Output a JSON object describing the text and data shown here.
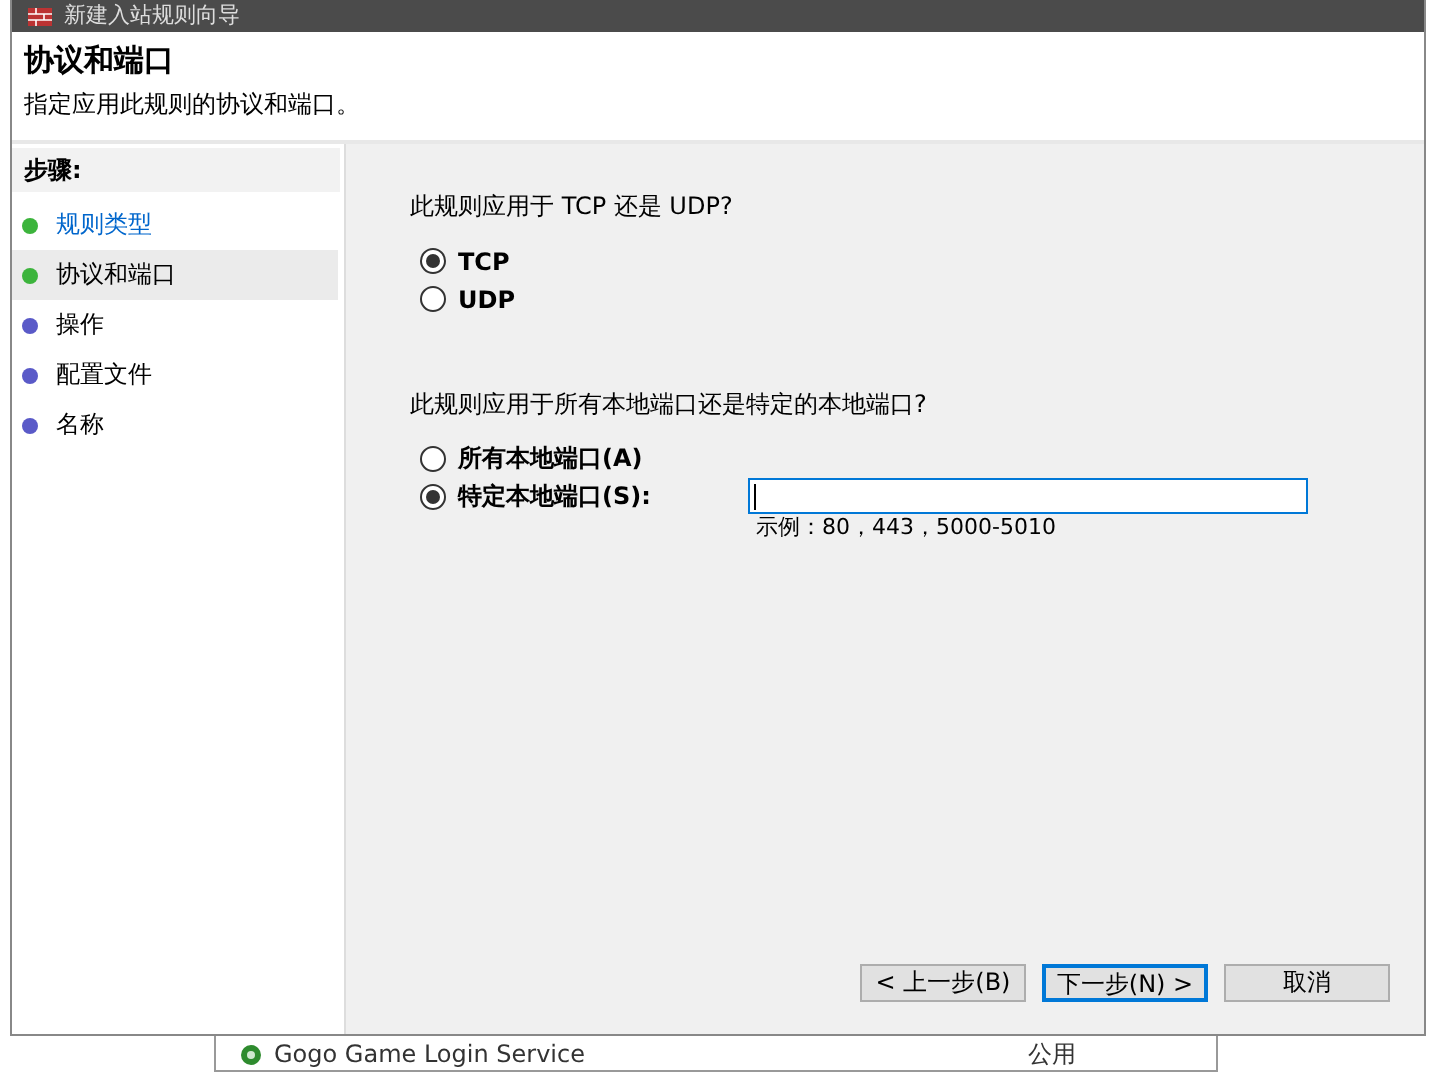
{
  "window": {
    "title": "新建入站规则向导"
  },
  "header": {
    "title": "协议和端口",
    "subtitle": "指定应用此规则的协议和端口。"
  },
  "steps": {
    "heading": "步骤:",
    "items": [
      {
        "label": "规则类型",
        "kind": "link",
        "color": "#3cb43c",
        "selected": false
      },
      {
        "label": "协议和端口",
        "kind": "plain",
        "color": "#3cb43c",
        "selected": true
      },
      {
        "label": "操作",
        "kind": "plain",
        "color": "#5a5ac8",
        "selected": false
      },
      {
        "label": "配置文件",
        "kind": "plain",
        "color": "#5a5ac8",
        "selected": false
      },
      {
        "label": "名称",
        "kind": "plain",
        "color": "#5a5ac8",
        "selected": false
      }
    ]
  },
  "protocol": {
    "question": "此规则应用于 TCP 还是 UDP?",
    "options": [
      {
        "label": "TCP",
        "selected": true
      },
      {
        "label": "UDP",
        "selected": false
      }
    ]
  },
  "ports": {
    "question": "此规则应用于所有本地端口还是特定的本地端口?",
    "options": [
      {
        "label": "所有本地端口(A)",
        "selected": false
      },
      {
        "label": "特定本地端口(S):",
        "selected": true
      }
    ],
    "field": {
      "focused": true
    },
    "hint": "示例：80，443，5000-5010"
  },
  "buttons": [
    {
      "label": "< 上一步(B)",
      "default": false
    },
    {
      "label": "下一步(N) >",
      "default": true
    },
    {
      "label": "取消",
      "default": false
    }
  ],
  "background_window": {
    "rows": [
      {
        "name": "Gogo Game Login Service",
        "profile": "公用"
      }
    ]
  }
}
